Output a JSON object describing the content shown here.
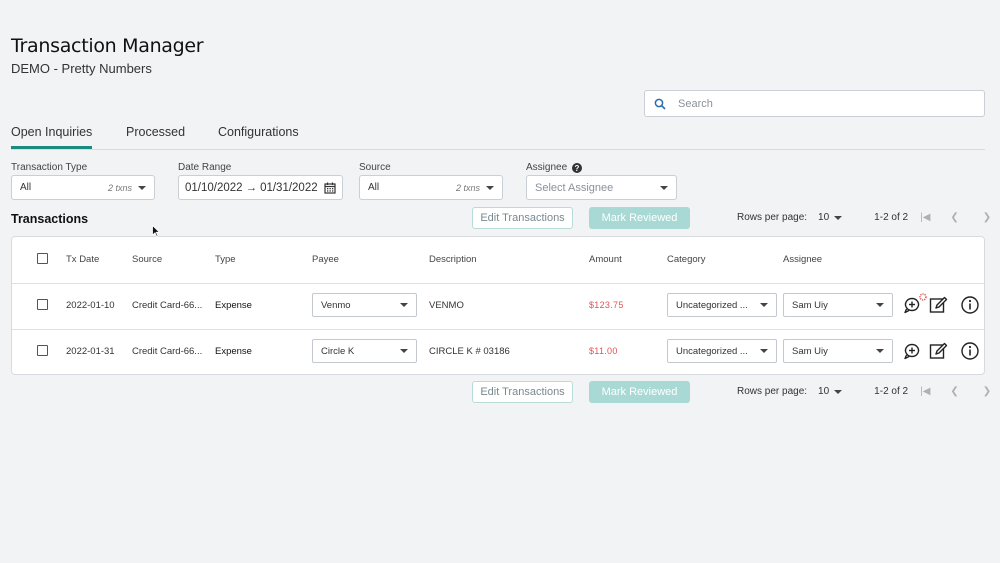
{
  "header": {
    "title": "Transaction Manager",
    "subtitle": "DEMO - Pretty Numbers"
  },
  "search": {
    "placeholder": "Search"
  },
  "tabs": [
    {
      "label": "Open Inquiries",
      "active": true
    },
    {
      "label": "Processed",
      "active": false
    },
    {
      "label": "Configurations",
      "active": false
    }
  ],
  "filters": {
    "transaction_type": {
      "label": "Transaction Type",
      "value": "All",
      "note": "2 txns"
    },
    "date_range": {
      "label": "Date Range",
      "start": "01/10/2022",
      "arrow": "→",
      "end": "01/31/2022"
    },
    "source": {
      "label": "Source",
      "value": "All",
      "note": "2 txns"
    },
    "assignee": {
      "label": "Assignee",
      "placeholder": "Select Assignee"
    }
  },
  "section_title": "Transactions",
  "actions": {
    "edit": "Edit Transactions",
    "mark": "Mark Reviewed"
  },
  "pagination": {
    "rows_label": "Rows per page:",
    "rows_value": "10",
    "range": "1-2 of 2"
  },
  "table": {
    "columns": [
      "Tx Date",
      "Source",
      "Type",
      "Payee",
      "Description",
      "Amount",
      "Category",
      "Assignee"
    ],
    "rows": [
      {
        "date": "2022-01-10",
        "source": "Credit Card-66...",
        "type": "Expense",
        "payee": "Venmo",
        "description": "VENMO",
        "amount": "$123.75",
        "category": "Uncategorized ...",
        "assignee": "Sam Uiy",
        "has_comment_badge": true
      },
      {
        "date": "2022-01-31",
        "source": "Credit Card-66...",
        "type": "Expense",
        "payee": "Circle K",
        "description": "CIRCLE K # 03186",
        "amount": "$11.00",
        "category": "Uncategorized ...",
        "assignee": "Sam Uiy",
        "has_comment_badge": false
      }
    ]
  },
  "colors": {
    "accent": "#1d8a7f",
    "button_fill": "#a9d9d4",
    "amount_red": "#e05555"
  }
}
